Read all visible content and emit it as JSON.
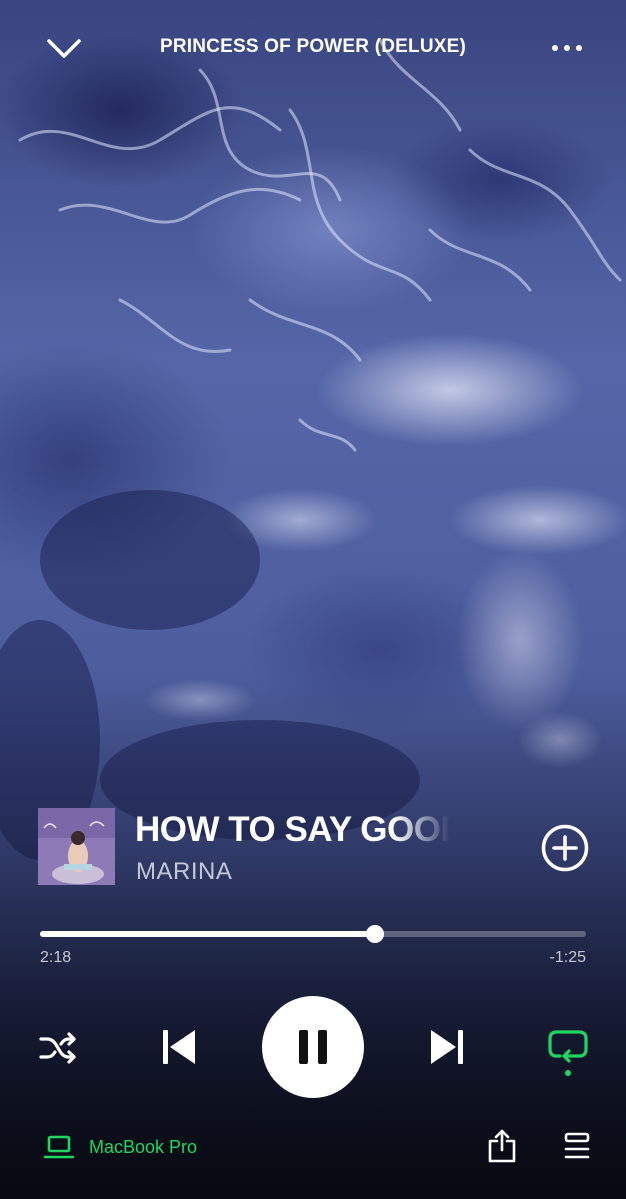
{
  "header": {
    "album_title": "PRINCESS OF POWER (DELUXE)",
    "collapse_icon": "chevron-down-icon",
    "more_icon": "ellipsis-icon"
  },
  "track": {
    "title": "HOW TO SAY GOODBYE",
    "artist": "MARINA",
    "cover_icon": "album-cover",
    "add_icon": "add-circle-icon"
  },
  "playback": {
    "elapsed": "2:18",
    "remaining": "-1:25",
    "progress_fraction": 0.614,
    "is_playing": true
  },
  "controls": {
    "shuffle_icon": "shuffle-icon",
    "previous_icon": "skip-previous-icon",
    "pause_icon": "pause-icon",
    "next_icon": "skip-next-icon",
    "repeat_icon": "repeat-icon",
    "repeat_active": true
  },
  "footer": {
    "device_name": "MacBook Pro",
    "device_icon": "laptop-icon",
    "share_icon": "share-icon",
    "queue_icon": "queue-icon"
  },
  "colors": {
    "accent": "#1ed760",
    "primary_text": "#ffffff",
    "background": "#3d4c86"
  }
}
